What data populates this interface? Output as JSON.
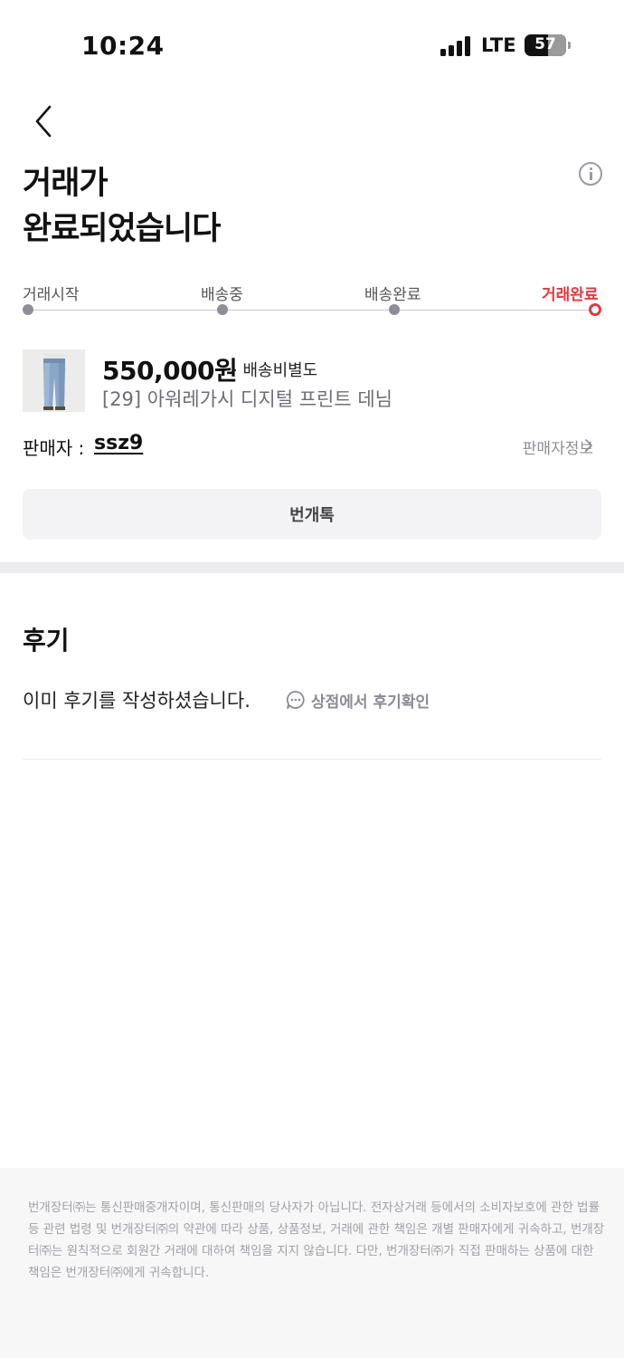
{
  "status_bar": {
    "time": "10:24",
    "network": "LTE",
    "battery": "57"
  },
  "header": {
    "back_icon": "chevron-left-icon",
    "info_icon": "info-icon",
    "title_line1": "거래가",
    "title_line2": "완료되었습니다"
  },
  "progress": {
    "steps": [
      {
        "label": "거래시작",
        "active": false
      },
      {
        "label": "배송중",
        "active": false
      },
      {
        "label": "배송완료",
        "active": false
      },
      {
        "label": "거래완료",
        "active": true
      }
    ],
    "active_color": "#e8373f"
  },
  "product": {
    "price": "550,000원",
    "shipping_note": "· 배송비별도",
    "name": "[29] 아워레가시 디지털 프린트 데님"
  },
  "seller": {
    "label": "판매자 :",
    "name": "ssz9",
    "info_link": "판매자정보"
  },
  "chat_button": "번개톡",
  "review": {
    "heading": "후기",
    "message": "이미 후기를 작성하셨습니다.",
    "link": "상점에서 후기확인"
  },
  "footer": {
    "text": "번개장터㈜는 통신판매중개자이며, 통신판매의 당사자가 아닙니다. 전자상거래 등에서의 소비자보호에 관한 법률 등 관련 법령 및 번개장터㈜의 약관에 따라 상품, 상품정보, 거래에 관한 책임은 개별 판매자에게 귀속하고, 번개장터㈜는 원칙적으로 회원간 거래에 대하여 책임을 지지 않습니다. 다만, 번개장터㈜가 직접 판매하는 상품에 대한 책임은 번개장터㈜에게 귀속합니다."
  }
}
